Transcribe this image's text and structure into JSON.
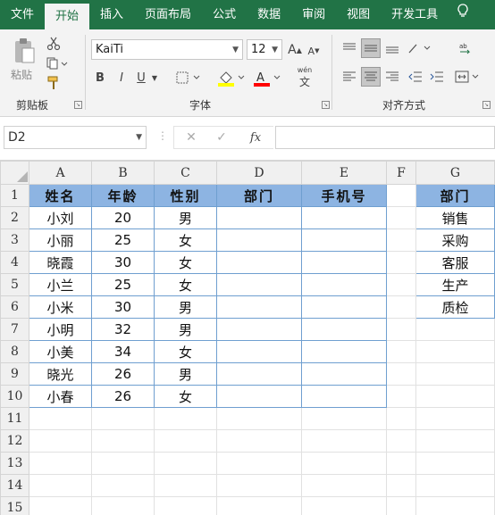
{
  "ribbon": {
    "tabs": [
      "文件",
      "开始",
      "插入",
      "页面布局",
      "公式",
      "数据",
      "审阅",
      "视图",
      "开发工具"
    ],
    "active_tab": "开始",
    "clipboard": {
      "paste_label": "粘贴",
      "group_label": "剪贴板"
    },
    "font": {
      "family": "KaiTi",
      "size": "12",
      "group_label": "字体",
      "bold": "B",
      "italic": "I",
      "underline": "U",
      "grow": "A",
      "shrink": "A",
      "phonetic": "wén",
      "highlight_color": "#ffff00",
      "font_color": "#ff0000"
    },
    "alignment": {
      "group_label": "对齐方式"
    }
  },
  "formula_bar": {
    "name_box": "D2",
    "cancel": "✕",
    "confirm": "✓",
    "fx": "fx",
    "formula": ""
  },
  "grid": {
    "columns": [
      "A",
      "B",
      "C",
      "D",
      "E",
      "F",
      "G"
    ],
    "rows": [
      "1",
      "2",
      "3",
      "4",
      "5",
      "6",
      "7",
      "8",
      "9",
      "10",
      "11",
      "12",
      "13",
      "14",
      "15"
    ],
    "main_table": {
      "headers": [
        "姓名",
        "年龄",
        "性别",
        "部门",
        "手机号"
      ],
      "rows": [
        [
          "小刘",
          "20",
          "男",
          "",
          ""
        ],
        [
          "小丽",
          "25",
          "女",
          "",
          ""
        ],
        [
          "晓霞",
          "30",
          "女",
          "",
          ""
        ],
        [
          "小兰",
          "25",
          "女",
          "",
          ""
        ],
        [
          "小米",
          "30",
          "男",
          "",
          ""
        ],
        [
          "小明",
          "32",
          "男",
          "",
          ""
        ],
        [
          "小美",
          "34",
          "女",
          "",
          ""
        ],
        [
          "晓光",
          "26",
          "男",
          "",
          ""
        ],
        [
          "小春",
          "26",
          "女",
          "",
          ""
        ]
      ]
    },
    "dept_table": {
      "header": "部门",
      "items": [
        "销售",
        "采购",
        "客服",
        "生产",
        "质检"
      ]
    },
    "header_fill": "#8db4e2"
  }
}
